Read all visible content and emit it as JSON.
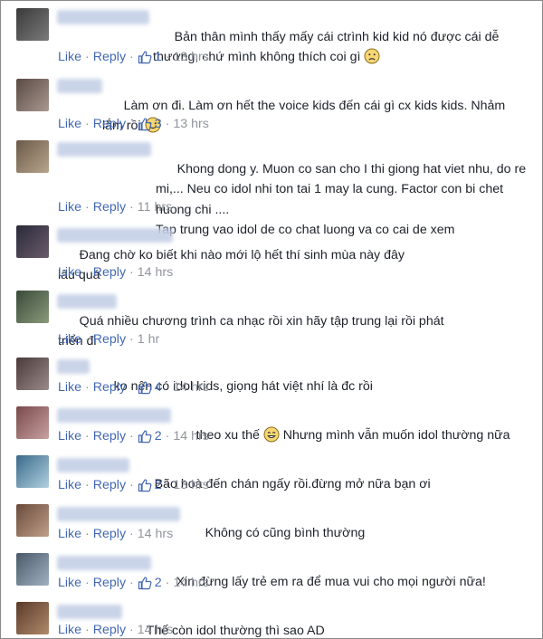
{
  "actions": {
    "like": "Like",
    "reply": "Reply",
    "separator": "·"
  },
  "comments": [
    {
      "text": "Bản thân mình thấy mấy cái ctrình kid kid nó được cái dễ\nthương, chứ mình không thích coi gì",
      "emoji": "sad",
      "likes": "1",
      "time": "13 hrs"
    },
    {
      "text": "Làm ơn đi. Làm ơn hết the voice kids đến cái gì cx kids kids. Nhảm\nlắm rồi",
      "emoji": "happy",
      "likes": "3",
      "time": "13 hrs"
    },
    {
      "text": "Khong dong y. Muon co san cho I thi giong hat viet nhu, do re\nmi,... Neu co idol nhi ton tai 1 may la cung. Factor con bi chet huong chi ....\nTap trung vao idol de co chat luong va co cai de xem",
      "emoji": "",
      "likes": "",
      "time": "11 hrs"
    },
    {
      "text": "Đang chờ ko biết khi nào mới lộ hết thí sinh mùa này đây\nlâu quá",
      "emoji": "",
      "likes": "",
      "time": "14 hrs"
    },
    {
      "text": "Quá nhiều chương trình ca nhạc rồi xin hãy tập trung lại rồi phát\ntriển đi",
      "emoji": "",
      "likes": "",
      "time": "1 hr"
    },
    {
      "text": "ko nên có idol kids, giọng hát việt nhí là đc rồi",
      "emoji": "",
      "likes": "4",
      "time": "14 hrs"
    },
    {
      "text": "theo xu thế",
      "emoji": "grin",
      "text2": " Nhưng mình vẫn muốn idol thường nữa",
      "likes": "2",
      "time": "14 hrs"
    },
    {
      "text": "Bão hoà đến chán ngấy rồi.đừng mở nữa bạn ơi",
      "emoji": "",
      "likes": "2",
      "time": "13 hrs"
    },
    {
      "text": "Không có cũng bình thường",
      "emoji": "",
      "likes": "",
      "time": "14 hrs"
    },
    {
      "text": "Xin đừng lấy trẻ em ra để mua vui cho mọi người nữa!",
      "emoji": "",
      "likes": "2",
      "time": "14 hrs"
    },
    {
      "text": "Thế còn idol thường thì sao AD",
      "emoji": "",
      "likes": "",
      "time": "14 hrs"
    }
  ],
  "colors": {
    "link": "#4267b2",
    "meta": "#90949c",
    "text": "#1d2129"
  }
}
